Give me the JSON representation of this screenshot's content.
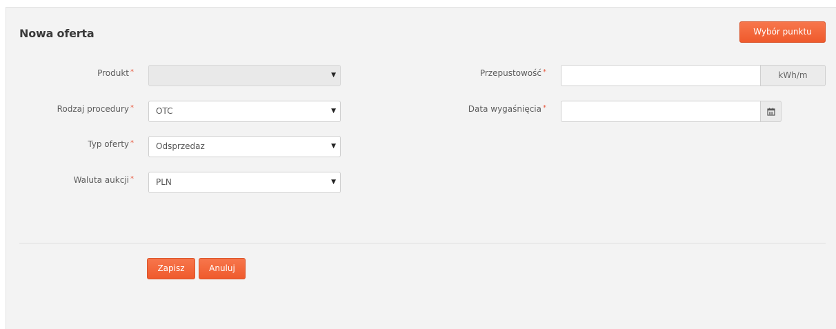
{
  "header": {
    "title": "Nowa oferta",
    "point_button": "Wybór punktu"
  },
  "form": {
    "required_mark": "*",
    "product": {
      "label": "Produkt",
      "value": ""
    },
    "procedure": {
      "label": "Rodzaj procedury",
      "value": "OTC"
    },
    "offer_type": {
      "label": "Typ oferty",
      "value": "Odsprzedaz"
    },
    "currency": {
      "label": "Waluta aukcji",
      "value": "PLN"
    },
    "capacity": {
      "label": "Przepustowość",
      "value": "",
      "unit": "kWh/m"
    },
    "expiry_date": {
      "label": "Data wygaśnięcia",
      "value": ""
    }
  },
  "footer": {
    "save_label": "Zapisz",
    "cancel_label": "Anuluj"
  },
  "icons": {
    "dropdown": "triangle-down-icon",
    "calendar": "calendar-icon"
  },
  "colors": {
    "accent": "#f0632f",
    "required": "#e8553a",
    "panel_bg": "#f3f3f3"
  }
}
